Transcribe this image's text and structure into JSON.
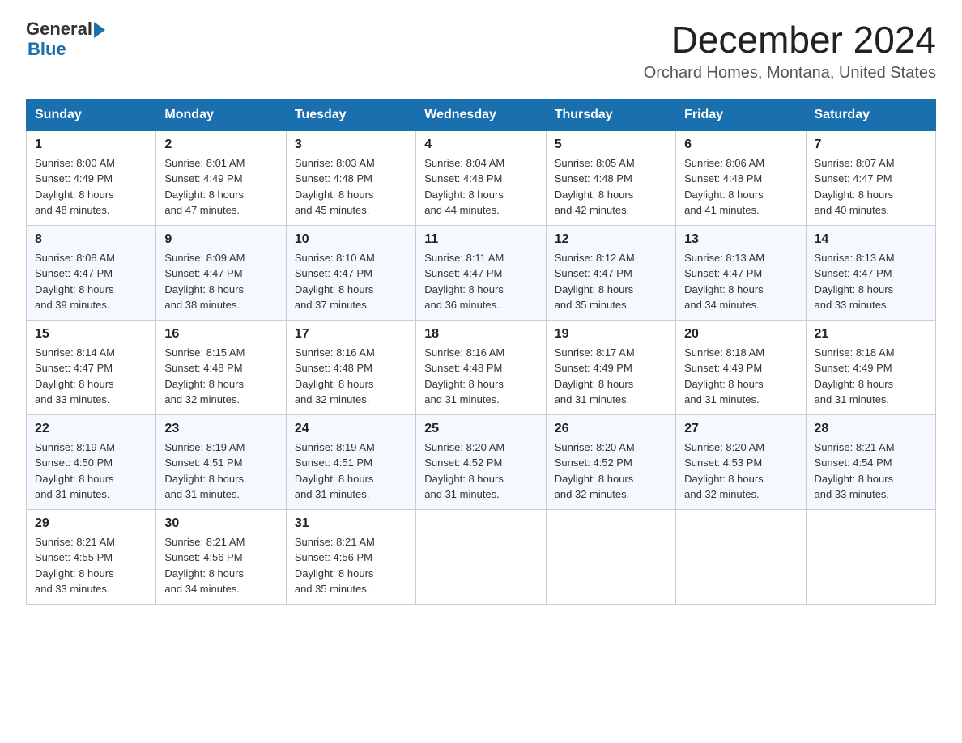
{
  "header": {
    "logo_general": "General",
    "logo_blue": "Blue",
    "month_title": "December 2024",
    "location": "Orchard Homes, Montana, United States"
  },
  "weekdays": [
    "Sunday",
    "Monday",
    "Tuesday",
    "Wednesday",
    "Thursday",
    "Friday",
    "Saturday"
  ],
  "weeks": [
    [
      {
        "day": "1",
        "sunrise": "8:00 AM",
        "sunset": "4:49 PM",
        "daylight": "8 hours and 48 minutes."
      },
      {
        "day": "2",
        "sunrise": "8:01 AM",
        "sunset": "4:49 PM",
        "daylight": "8 hours and 47 minutes."
      },
      {
        "day": "3",
        "sunrise": "8:03 AM",
        "sunset": "4:48 PM",
        "daylight": "8 hours and 45 minutes."
      },
      {
        "day": "4",
        "sunrise": "8:04 AM",
        "sunset": "4:48 PM",
        "daylight": "8 hours and 44 minutes."
      },
      {
        "day": "5",
        "sunrise": "8:05 AM",
        "sunset": "4:48 PM",
        "daylight": "8 hours and 42 minutes."
      },
      {
        "day": "6",
        "sunrise": "8:06 AM",
        "sunset": "4:48 PM",
        "daylight": "8 hours and 41 minutes."
      },
      {
        "day": "7",
        "sunrise": "8:07 AM",
        "sunset": "4:47 PM",
        "daylight": "8 hours and 40 minutes."
      }
    ],
    [
      {
        "day": "8",
        "sunrise": "8:08 AM",
        "sunset": "4:47 PM",
        "daylight": "8 hours and 39 minutes."
      },
      {
        "day": "9",
        "sunrise": "8:09 AM",
        "sunset": "4:47 PM",
        "daylight": "8 hours and 38 minutes."
      },
      {
        "day": "10",
        "sunrise": "8:10 AM",
        "sunset": "4:47 PM",
        "daylight": "8 hours and 37 minutes."
      },
      {
        "day": "11",
        "sunrise": "8:11 AM",
        "sunset": "4:47 PM",
        "daylight": "8 hours and 36 minutes."
      },
      {
        "day": "12",
        "sunrise": "8:12 AM",
        "sunset": "4:47 PM",
        "daylight": "8 hours and 35 minutes."
      },
      {
        "day": "13",
        "sunrise": "8:13 AM",
        "sunset": "4:47 PM",
        "daylight": "8 hours and 34 minutes."
      },
      {
        "day": "14",
        "sunrise": "8:13 AM",
        "sunset": "4:47 PM",
        "daylight": "8 hours and 33 minutes."
      }
    ],
    [
      {
        "day": "15",
        "sunrise": "8:14 AM",
        "sunset": "4:47 PM",
        "daylight": "8 hours and 33 minutes."
      },
      {
        "day": "16",
        "sunrise": "8:15 AM",
        "sunset": "4:48 PM",
        "daylight": "8 hours and 32 minutes."
      },
      {
        "day": "17",
        "sunrise": "8:16 AM",
        "sunset": "4:48 PM",
        "daylight": "8 hours and 32 minutes."
      },
      {
        "day": "18",
        "sunrise": "8:16 AM",
        "sunset": "4:48 PM",
        "daylight": "8 hours and 31 minutes."
      },
      {
        "day": "19",
        "sunrise": "8:17 AM",
        "sunset": "4:49 PM",
        "daylight": "8 hours and 31 minutes."
      },
      {
        "day": "20",
        "sunrise": "8:18 AM",
        "sunset": "4:49 PM",
        "daylight": "8 hours and 31 minutes."
      },
      {
        "day": "21",
        "sunrise": "8:18 AM",
        "sunset": "4:49 PM",
        "daylight": "8 hours and 31 minutes."
      }
    ],
    [
      {
        "day": "22",
        "sunrise": "8:19 AM",
        "sunset": "4:50 PM",
        "daylight": "8 hours and 31 minutes."
      },
      {
        "day": "23",
        "sunrise": "8:19 AM",
        "sunset": "4:51 PM",
        "daylight": "8 hours and 31 minutes."
      },
      {
        "day": "24",
        "sunrise": "8:19 AM",
        "sunset": "4:51 PM",
        "daylight": "8 hours and 31 minutes."
      },
      {
        "day": "25",
        "sunrise": "8:20 AM",
        "sunset": "4:52 PM",
        "daylight": "8 hours and 31 minutes."
      },
      {
        "day": "26",
        "sunrise": "8:20 AM",
        "sunset": "4:52 PM",
        "daylight": "8 hours and 32 minutes."
      },
      {
        "day": "27",
        "sunrise": "8:20 AM",
        "sunset": "4:53 PM",
        "daylight": "8 hours and 32 minutes."
      },
      {
        "day": "28",
        "sunrise": "8:21 AM",
        "sunset": "4:54 PM",
        "daylight": "8 hours and 33 minutes."
      }
    ],
    [
      {
        "day": "29",
        "sunrise": "8:21 AM",
        "sunset": "4:55 PM",
        "daylight": "8 hours and 33 minutes."
      },
      {
        "day": "30",
        "sunrise": "8:21 AM",
        "sunset": "4:56 PM",
        "daylight": "8 hours and 34 minutes."
      },
      {
        "day": "31",
        "sunrise": "8:21 AM",
        "sunset": "4:56 PM",
        "daylight": "8 hours and 35 minutes."
      },
      null,
      null,
      null,
      null
    ]
  ],
  "labels": {
    "sunrise": "Sunrise:",
    "sunset": "Sunset:",
    "daylight": "Daylight:"
  }
}
